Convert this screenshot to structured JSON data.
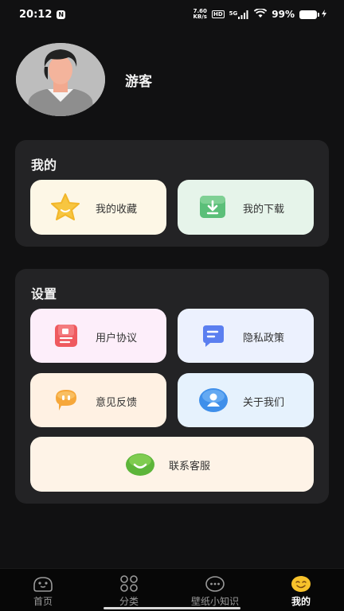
{
  "status_bar": {
    "time": "20:12",
    "time_badge": "N",
    "net_speed_value": "7.60",
    "net_speed_unit": "KB/s",
    "hd_label": "HD",
    "signal_label": "5G",
    "battery": "99%"
  },
  "profile": {
    "username": "游客"
  },
  "mine_section": {
    "title": "我的",
    "items": [
      {
        "label": "我的收藏",
        "icon": "star-icon"
      },
      {
        "label": "我的下载",
        "icon": "download-icon"
      }
    ]
  },
  "settings_section": {
    "title": "设置",
    "items": [
      {
        "label": "用户协议",
        "icon": "agreement-icon"
      },
      {
        "label": "隐私政策",
        "icon": "privacy-policy-icon"
      },
      {
        "label": "意见反馈",
        "icon": "feedback-icon"
      },
      {
        "label": "关于我们",
        "icon": "about-icon"
      },
      {
        "label": "联系客服",
        "icon": "customer-service-icon"
      }
    ]
  },
  "bottom_nav": {
    "items": [
      {
        "label": "首页",
        "icon": "home-icon"
      },
      {
        "label": "分类",
        "icon": "category-icon"
      },
      {
        "label": "壁纸小知识",
        "icon": "more-dots-icon"
      },
      {
        "label": "我的",
        "icon": "smiley-icon",
        "active": true
      }
    ]
  },
  "colors": {
    "background": "#111112",
    "card": "#232325",
    "tile_favorites": "#fdf7e6",
    "tile_downloads": "#e6f4ea",
    "tile_agreement": "#fdeefa",
    "tile_privacy": "#ecf1fe",
    "tile_feedback": "#fff1e3",
    "tile_about": "#e6f2fd",
    "tile_contact": "#fef3e7"
  }
}
